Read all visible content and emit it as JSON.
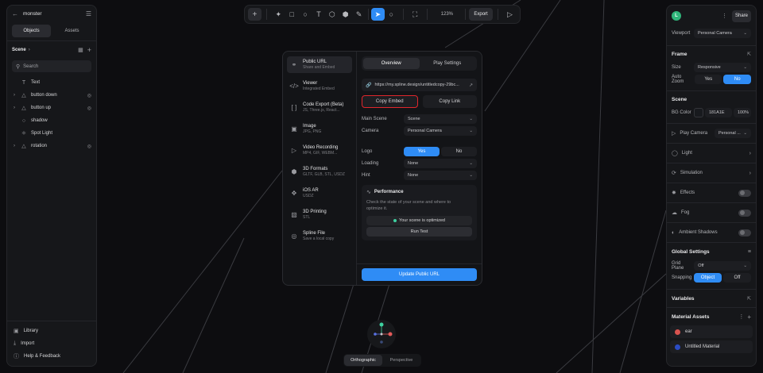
{
  "app": {
    "project_name": "monster"
  },
  "left_panel": {
    "tabs": [
      "Objects",
      "Assets"
    ],
    "scene_label": "Scene",
    "search_placeholder": "Search",
    "tree": [
      {
        "label": "Text",
        "icon": "text-icon",
        "expandable": false
      },
      {
        "label": "button down",
        "icon": "object-icon",
        "expandable": true
      },
      {
        "label": "button up",
        "icon": "object-icon",
        "expandable": true
      },
      {
        "label": "shadow",
        "icon": "circle-icon",
        "expandable": false
      },
      {
        "label": "Spot Light",
        "icon": "light-icon",
        "expandable": false
      },
      {
        "label": "rotation",
        "icon": "object-icon",
        "expandable": true
      }
    ],
    "footer": [
      "Library",
      "Import",
      "Help & Feedback"
    ]
  },
  "toolbar": {
    "zoom": "123%",
    "export_label": "Export"
  },
  "modal": {
    "sidebar": [
      {
        "title": "Public URL",
        "sub": "Share and Embed",
        "icon": "link-icon"
      },
      {
        "title": "Viewer",
        "sub": "Integrated Embed",
        "icon": "code-icon"
      },
      {
        "title": "Code Export (Beta)",
        "sub": "JS, Three.js, React...",
        "icon": "brackets-icon"
      },
      {
        "title": "Image",
        "sub": "JPG, PNG",
        "icon": "image-icon"
      },
      {
        "title": "Video Recording",
        "sub": "MP4, GIF, WEBM...",
        "icon": "play-icon"
      },
      {
        "title": "3D Formats",
        "sub": "GLTF, GLB, STL, USDZ",
        "icon": "cube-icon"
      },
      {
        "title": "iOS AR",
        "sub": "USDZ",
        "icon": "ar-icon"
      },
      {
        "title": "3D Printing",
        "sub": "STL",
        "icon": "printer-icon"
      },
      {
        "title": "Spline File",
        "sub": "Save a local copy",
        "icon": "file-icon"
      }
    ],
    "tabs": [
      "Overview",
      "Play Settings"
    ],
    "url": "https://my.spline.design/untitledcopy-29bc...",
    "copy_embed": "Copy Embed",
    "copy_link": "Copy Link",
    "main_scene_label": "Main Scene",
    "main_scene_value": "Scene",
    "camera_label": "Camera",
    "camera_value": "Personal Camera",
    "logo_label": "Logo",
    "logo_yes": "Yes",
    "logo_no": "No",
    "loading_label": "Loading",
    "loading_value": "None",
    "hint_label": "Hint",
    "hint_value": "None",
    "perf_title": "Performance",
    "perf_desc": "Check the state of your scene and where to optimize it.",
    "perf_status": "Your scene is optimized",
    "run_test": "Run Test",
    "update_button": "Update Public URL"
  },
  "right_panel": {
    "avatar_letter": "L",
    "share_label": "Share",
    "viewport_label": "Viewport",
    "viewport_value": "Personal Camera",
    "frame_title": "Frame",
    "size_label": "Size",
    "size_value": "Responsive",
    "autozoom_label": "Auto Zoom",
    "autozoom_yes": "Yes",
    "autozoom_no": "No",
    "scene_title": "Scene",
    "bg_label": "BG Color",
    "bg_hex": "181A1E",
    "bg_opacity": "100%",
    "bg_color": "#181a1e",
    "play_camera_label": "Play Camera",
    "play_camera_value": "Personal ...",
    "light": "Light",
    "simulation": "Simulation",
    "effects": "Effects",
    "fog": "Fog",
    "ambient_shadows": "Ambient Shadows",
    "global_title": "Global Settings",
    "grid_plane_label": "Grid Plane",
    "grid_plane_value": "Off",
    "snapping_label": "Snapping",
    "snapping_object": "Object",
    "snapping_off": "Off",
    "variables_title": "Variables",
    "material_title": "Material Assets",
    "materials": [
      {
        "name": "ear",
        "color": "#d9534f"
      },
      {
        "name": "Untitled Material",
        "color": "#2b4cc4"
      }
    ]
  },
  "view_toggle": {
    "ortho": "Orthographic",
    "persp": "Perspective"
  },
  "colors": {
    "accent": "#2f8cf5",
    "highlight_border": "#e0262c"
  }
}
